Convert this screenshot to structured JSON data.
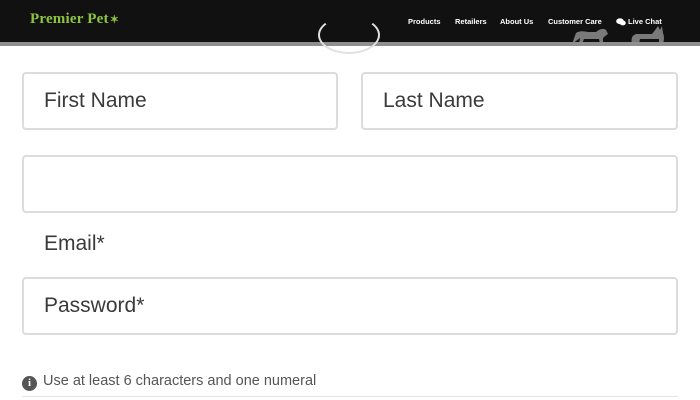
{
  "header": {
    "logo": "Premier Pet",
    "nav": [
      "Products",
      "Retailers",
      "About Us",
      "Customer Care",
      "Live Chat"
    ]
  },
  "form": {
    "first_name_placeholder": "First Name",
    "last_name_placeholder": "Last Name",
    "email_label": "Email*",
    "password_placeholder": "Password*",
    "hint": "Use at least 6 characters and one numeral"
  },
  "icons": {
    "info": "info-icon",
    "chat": "chat-bubbles-icon",
    "pets": "dog-and-cat-silhouette-icon"
  },
  "colors": {
    "header_bg": "#111111",
    "logo": "#8cc63f",
    "field_border": "#dcdcdc"
  }
}
